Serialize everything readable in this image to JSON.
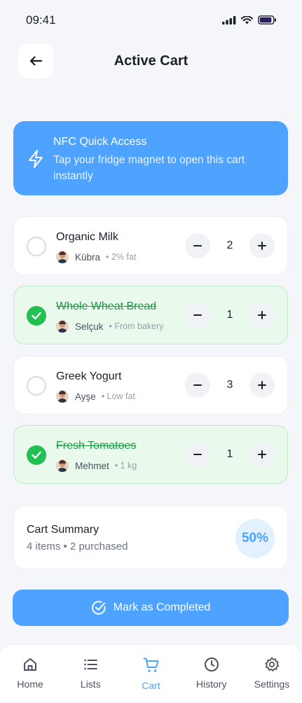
{
  "status": {
    "time": "09:41"
  },
  "header": {
    "title": "Active Cart"
  },
  "nfc": {
    "title": "NFC Quick Access",
    "description": "Tap your fridge magnet to open this cart instantly"
  },
  "items": [
    {
      "name": "Organic Milk",
      "user": "Kübra",
      "note": "• 2% fat",
      "qty": "2",
      "purchased": false
    },
    {
      "name": "Whole Wheat Bread",
      "user": "Selçuk",
      "note": "• From bakery",
      "qty": "1",
      "purchased": true
    },
    {
      "name": "Greek Yogurt",
      "user": "Ayşe",
      "note": "• Low fat",
      "qty": "3",
      "purchased": false
    },
    {
      "name": "Fresh Tomatoes",
      "user": "Mehmet",
      "note": "• 1 kg",
      "qty": "1",
      "purchased": true
    }
  ],
  "summary": {
    "title": "Cart Summary",
    "subtitle": "4 items • 2 purchased",
    "percent": "50%"
  },
  "actions": {
    "complete_label": "Mark as Completed"
  },
  "nav": {
    "items": [
      {
        "label": "Home",
        "icon": "home-icon"
      },
      {
        "label": "Lists",
        "icon": "list-icon"
      },
      {
        "label": "Cart",
        "icon": "cart-icon",
        "active": true
      },
      {
        "label": "History",
        "icon": "clock-icon"
      },
      {
        "label": "Settings",
        "icon": "gear-icon"
      }
    ]
  },
  "colors": {
    "accent": "#4da3ff",
    "success": "#22bf52",
    "success_bg": "#e9f9ec",
    "text": "#1b1f2a"
  }
}
